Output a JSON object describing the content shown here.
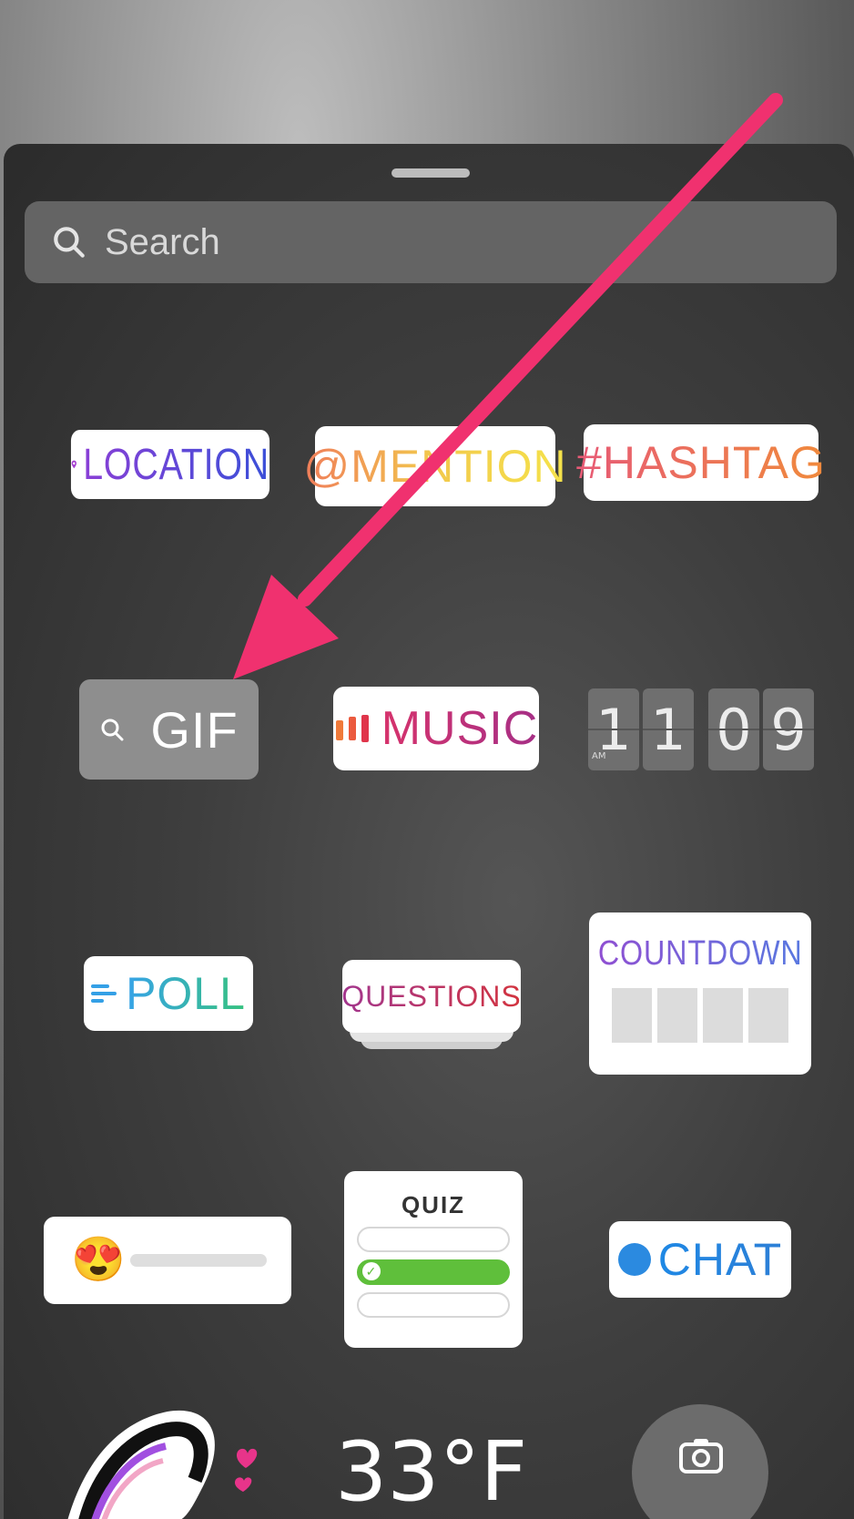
{
  "search": {
    "placeholder": "Search"
  },
  "stickers": {
    "location": "LOCATION",
    "mention": "@MENTION",
    "hashtag": "#HASHTAG",
    "gif": "GIF",
    "music": "MUSIC",
    "clock": {
      "ampm": "AM",
      "digits": [
        "1",
        "1",
        "0",
        "9"
      ]
    },
    "poll": "POLL",
    "questions": "QUESTIONS",
    "countdown": "COUNTDOWN",
    "slider_emoji": "😍",
    "quiz": "QUIZ",
    "chat": "CHAT",
    "temperature": "33°F"
  },
  "colors": {
    "annotation_arrow": "#f0316f"
  }
}
